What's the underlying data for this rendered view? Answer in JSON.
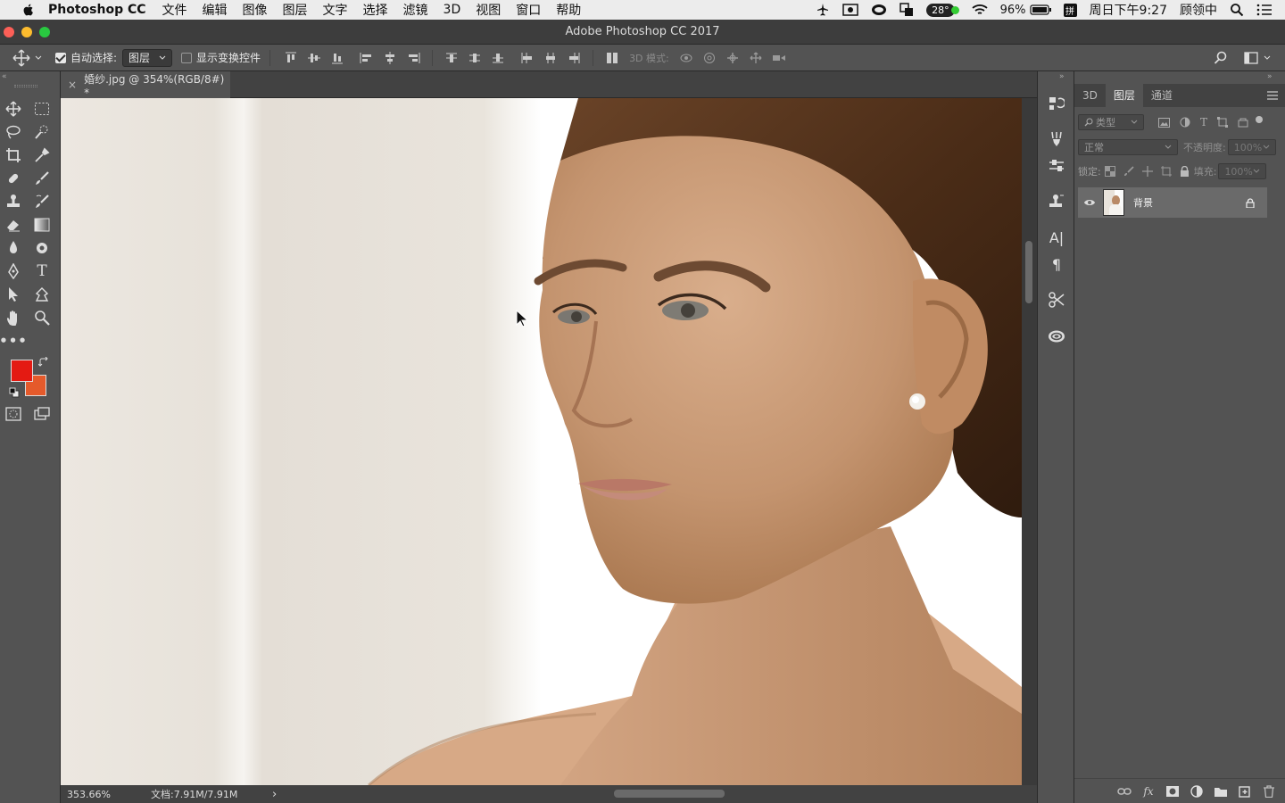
{
  "macmenu": {
    "app_name": "Photoshop CC",
    "items": [
      "文件",
      "编辑",
      "图像",
      "图层",
      "文字",
      "选择",
      "滤镜",
      "3D",
      "视图",
      "窗口",
      "帮助"
    ],
    "temperature": "28°",
    "battery": "96%",
    "input_method": "拼",
    "datetime": "周日下午9:27",
    "user": "顾领中"
  },
  "window": {
    "title": "Adobe Photoshop CC 2017"
  },
  "options": {
    "auto_select_label": "自动选择:",
    "auto_select_value": "图层",
    "show_transform_label": "显示变换控件",
    "mode_3d_label": "3D 模式:"
  },
  "document": {
    "tab_title": "婚纱.jpg @ 354%(RGB/8#) *",
    "close_glyph": "×",
    "zoom": "353.66%",
    "doc_size": "文档:7.91M/7.91M",
    "status_arrow": "›"
  },
  "layers_panel": {
    "tabs": [
      "3D",
      "图层",
      "通道"
    ],
    "active_tab": 1,
    "filter_label": "类型",
    "blend_mode": "正常",
    "opacity_label": "不透明度:",
    "opacity_value": "100%",
    "lock_label": "锁定:",
    "fill_label": "填充:",
    "fill_value": "100%",
    "layers": [
      {
        "name": "背景",
        "visible": true,
        "locked": true
      }
    ]
  },
  "colors": {
    "foreground": "#e41a12",
    "background": "#e55a2b",
    "accent_active_tab": "#535353"
  }
}
